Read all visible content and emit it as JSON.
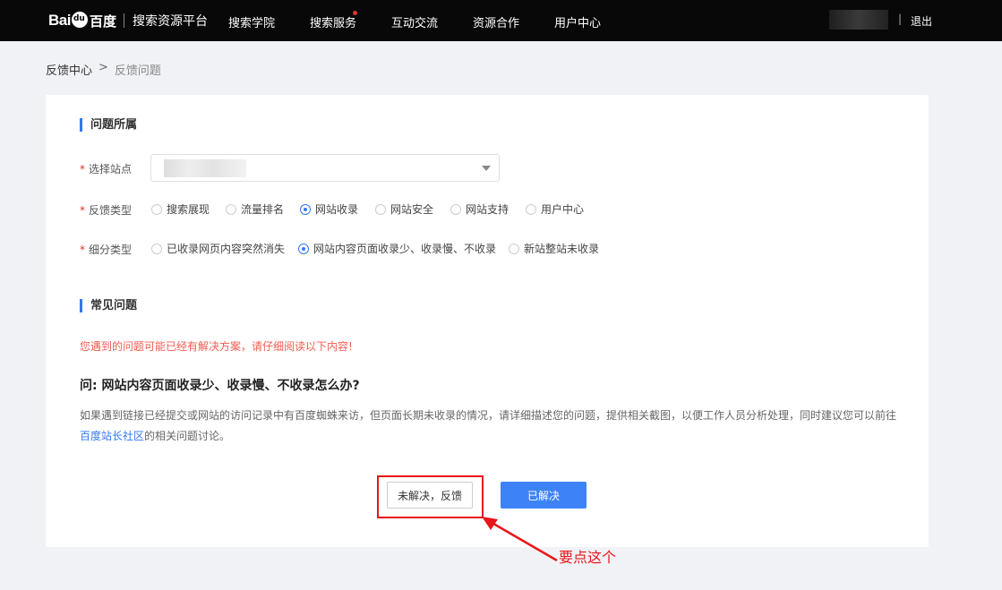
{
  "topbar": {
    "logo_brand": "Bai",
    "logo_brand2": "百度",
    "platform": "搜索资源平台",
    "nav": [
      "搜索学院",
      "搜索服务",
      "互动交流",
      "资源合作",
      "用户中心"
    ],
    "separator": "|",
    "logout": "退出"
  },
  "breadcrumb": {
    "root": "反馈中心",
    "sep": ">",
    "current": "反馈问题"
  },
  "form": {
    "section1_title": "问题所属",
    "site_label": "选择站点",
    "type_label": "反馈类型",
    "types": [
      {
        "label": "搜索展现",
        "checked": false
      },
      {
        "label": "流量排名",
        "checked": false
      },
      {
        "label": "网站收录",
        "checked": true
      },
      {
        "label": "网站安全",
        "checked": false
      },
      {
        "label": "网站支持",
        "checked": false
      },
      {
        "label": "用户中心",
        "checked": false
      }
    ],
    "subtype_label": "细分类型",
    "subtypes": [
      {
        "label": "已收录网页内容突然消失",
        "checked": false
      },
      {
        "label": "网站内容页面收录少、收录慢、不收录",
        "checked": true
      },
      {
        "label": "新站整站未收录",
        "checked": false
      }
    ],
    "required_mark": "*"
  },
  "faq": {
    "section_title": "常见问题",
    "warning": "您遇到的问题可能已经有解决方案，请仔细阅读以下内容!",
    "question": "问: 网站内容页面收录少、收录慢、不收录怎么办?",
    "answer_before": "如果遇到链接已经提交或网站的访问记录中有百度蜘蛛来访，但页面长期未收录的情况，请详细描述您的问题，提供相关截图，以便工作人员分析处理，同时建议您可以前往",
    "answer_link": "百度站长社区",
    "answer_after": "的相关问题讨论。"
  },
  "buttons": {
    "unsolved": "未解决，反馈",
    "solved": "已解决"
  },
  "annotation": {
    "text": "要点这个",
    "color": "#e8161a"
  },
  "colors": {
    "accent": "#3377f2",
    "topbar": "#080808",
    "warning": "#f25c4f"
  }
}
